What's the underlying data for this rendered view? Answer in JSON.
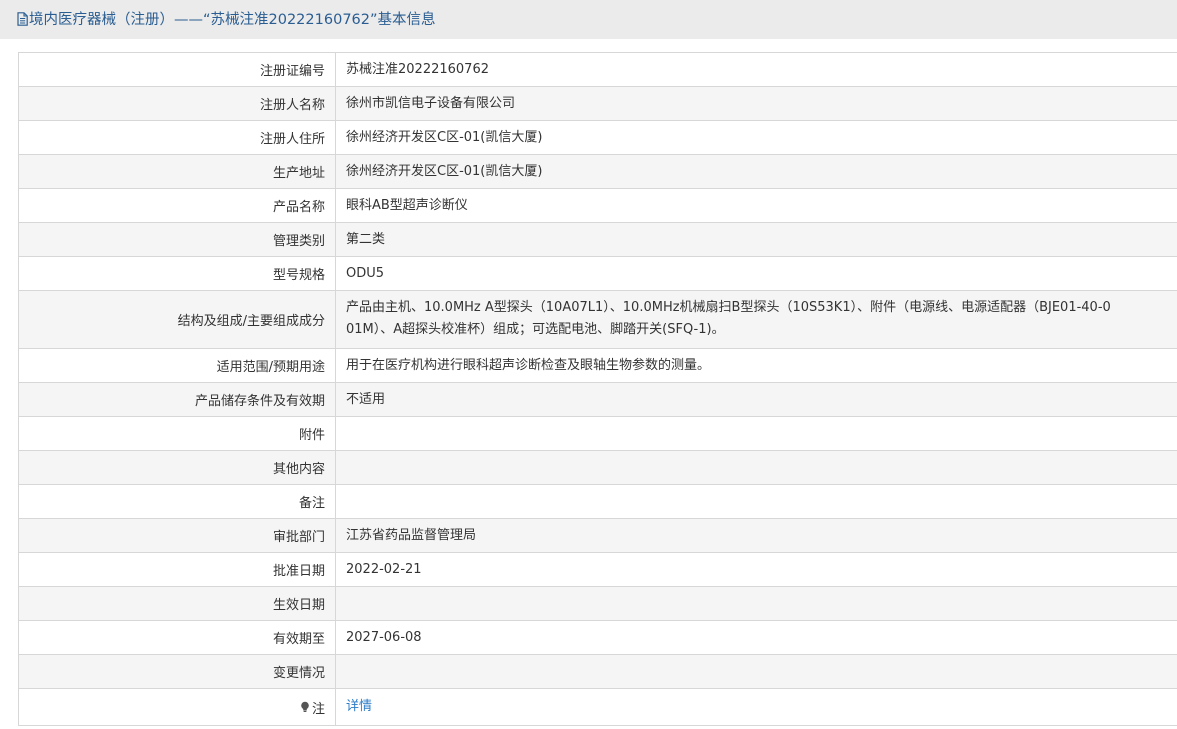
{
  "header": {
    "title": "境内医疗器械（注册）——“苏械注准20222160762”基本信息"
  },
  "rows": [
    {
      "label": "注册证编号",
      "value": "苏械注准20222160762"
    },
    {
      "label": "注册人名称",
      "value": "徐州市凯信电子设备有限公司"
    },
    {
      "label": "注册人住所",
      "value": "徐州经济开发区C区-01(凯信大厦)"
    },
    {
      "label": "生产地址",
      "value": "徐州经济开发区C区-01(凯信大厦)"
    },
    {
      "label": "产品名称",
      "value": "眼科AB型超声诊断仪"
    },
    {
      "label": "管理类别",
      "value": "第二类"
    },
    {
      "label": "型号规格",
      "value": "ODU5"
    },
    {
      "label": "结构及组成/主要组成成分",
      "value_line1": "产品由主机、10.0MHz A型探头（10A07L1）、10.0MHz机械扇扫B型探头（10S53K1）、附件（电源线、电源适配器（BJE01-40-0",
      "value_line2": "01M）、A超探头校准杯）组成；可选配电池、脚踏开关(SFQ-1)。"
    },
    {
      "label": "适用范围/预期用途",
      "value": "用于在医疗机构进行眼科超声诊断检查及眼轴生物参数的测量。"
    },
    {
      "label": "产品储存条件及有效期",
      "value": "不适用"
    },
    {
      "label": "附件",
      "value": ""
    },
    {
      "label": "其他内容",
      "value": ""
    },
    {
      "label": "备注",
      "value": ""
    },
    {
      "label": "审批部门",
      "value": "江苏省药品监督管理局"
    },
    {
      "label": "批准日期",
      "value": "2022-02-21"
    },
    {
      "label": "生效日期",
      "value": ""
    },
    {
      "label": "有效期至",
      "value": "2027-06-08"
    },
    {
      "label": "变更情况",
      "value": ""
    },
    {
      "label": "注",
      "value": "详情"
    }
  ],
  "colors": {
    "header_bg": "#ebebeb",
    "header_text": "#2a5d92",
    "link": "#2c7cc8",
    "border": "#d7d7d7",
    "alt_row": "#f5f5f5"
  },
  "icons": {
    "header": "document-icon",
    "note": "lightbulb-icon"
  }
}
